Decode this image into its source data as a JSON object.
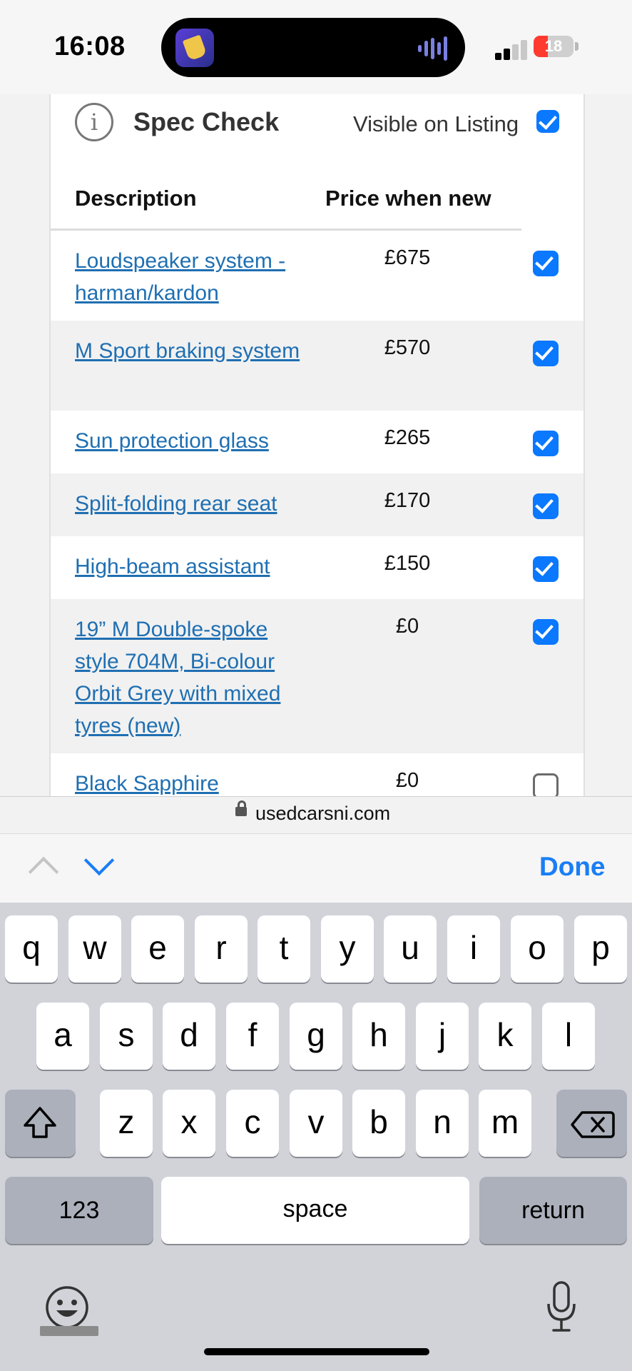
{
  "status_bar": {
    "time": "16:08",
    "battery_level": "18",
    "battery_color": "#ff3b30"
  },
  "spec_check": {
    "info_icon_glyph": "i",
    "title": "Spec Check",
    "visible_label": "Visible on Listing",
    "visible_checked": true,
    "columns": [
      "Description",
      "Price when new"
    ],
    "rows": [
      {
        "description": "Loudspeaker system - harman/kardon",
        "price": "£675",
        "checked": true
      },
      {
        "description": "M Sport braking system",
        "price": "£570",
        "checked": true
      },
      {
        "description": "Sun protection glass",
        "price": "£265",
        "checked": true
      },
      {
        "description": "Split-folding rear seat",
        "price": "£170",
        "checked": true
      },
      {
        "description": "High-beam assistant",
        "price": "£150",
        "checked": true
      },
      {
        "description": "19” M Double-spoke style 704M, Bi-colour Orbit Grey with mixed tyres (new)",
        "price": "£0",
        "checked": true
      },
      {
        "description": "Black Sapphire",
        "price": "£0",
        "checked": false
      }
    ]
  },
  "browser": {
    "url": "usedcarsni.com"
  },
  "keyboard_toolbar": {
    "done_label": "Done"
  },
  "keyboard": {
    "row1": [
      "q",
      "w",
      "e",
      "r",
      "t",
      "y",
      "u",
      "i",
      "o",
      "p"
    ],
    "row2": [
      "a",
      "s",
      "d",
      "f",
      "g",
      "h",
      "j",
      "k",
      "l"
    ],
    "row3": [
      "z",
      "x",
      "c",
      "v",
      "b",
      "n",
      "m"
    ],
    "numbers_label": "123",
    "space_label": "space",
    "return_label": "return"
  },
  "colors": {
    "accent": "#0a78ff",
    "link": "#1f6fb2",
    "done": "#1a7ef5"
  }
}
